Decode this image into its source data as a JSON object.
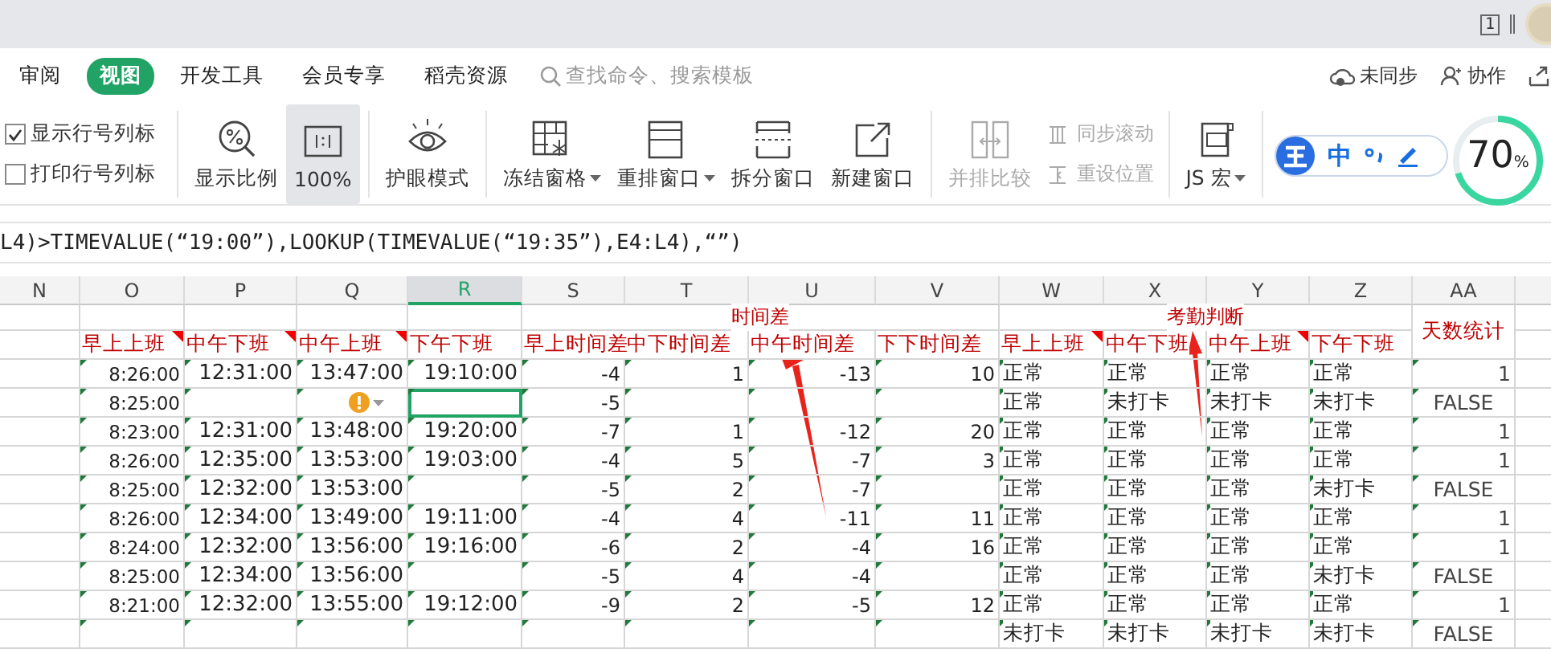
{
  "title_bar": {
    "page_indicator": "1"
  },
  "menu_tabs": [
    {
      "label": "审阅",
      "selected": false
    },
    {
      "label": "视图",
      "selected": true
    },
    {
      "label": "开发工具",
      "selected": false
    },
    {
      "label": "会员专享",
      "selected": false
    },
    {
      "label": "稻壳资源",
      "selected": false
    }
  ],
  "search": {
    "placeholder": "查找命令、搜索模板"
  },
  "header_actions": [
    {
      "label": "未同步",
      "kind": "cloud"
    },
    {
      "label": "协作",
      "kind": "person"
    }
  ],
  "ribbon": {
    "checkboxes": [
      {
        "label": "显示行号列标",
        "checked": true
      },
      {
        "label": "打印行号列标",
        "checked": false
      }
    ],
    "buttons": [
      {
        "label": "显示比例",
        "kind": "zoom",
        "selected": false,
        "disabled": false,
        "dropdown": false
      },
      {
        "label": "100%",
        "kind": "ratio",
        "selected": true,
        "disabled": false,
        "dropdown": false
      },
      {
        "label": "护眼模式",
        "kind": "eye",
        "selected": false,
        "disabled": false,
        "dropdown": false
      },
      {
        "label": "冻结窗格",
        "kind": "freeze",
        "selected": false,
        "disabled": false,
        "dropdown": true
      },
      {
        "label": "重排窗口",
        "kind": "arrange",
        "selected": false,
        "disabled": false,
        "dropdown": true
      },
      {
        "label": "拆分窗口",
        "kind": "split",
        "selected": false,
        "disabled": false,
        "dropdown": false
      },
      {
        "label": "新建窗口",
        "kind": "newwin",
        "selected": false,
        "disabled": false,
        "dropdown": false
      },
      {
        "label": "并排比较",
        "kind": "compare",
        "selected": false,
        "disabled": true,
        "dropdown": false
      }
    ],
    "small_buttons": [
      {
        "label": "同步滚动",
        "kind": "sync",
        "disabled": true
      },
      {
        "label": "重设位置",
        "kind": "reset",
        "disabled": true
      }
    ],
    "macro_button": {
      "label": "JS 宏",
      "dropdown": true
    }
  },
  "ime_bar": {
    "label": "中"
  },
  "score_ring": {
    "level": 0.7,
    "reading": "70",
    "unit": "%"
  },
  "formula": {
    "text": "L4)>TIMEVALUE(“19:00”),LOOKUP(TIMEVALUE(“19:35”),E4:L4),“”)"
  },
  "sheet": {
    "columns": [
      {
        "label": "N",
        "selected": false
      },
      {
        "label": "O",
        "selected": false
      },
      {
        "label": "P",
        "selected": false
      },
      {
        "label": "Q",
        "selected": false
      },
      {
        "label": "R",
        "selected": true
      },
      {
        "label": "S",
        "selected": false
      },
      {
        "label": "T",
        "selected": false
      },
      {
        "label": "U",
        "selected": false
      },
      {
        "label": "V",
        "selected": false
      },
      {
        "label": "W",
        "selected": false
      },
      {
        "label": "X",
        "selected": false
      },
      {
        "label": "Y",
        "selected": false
      },
      {
        "label": "Z",
        "selected": false
      },
      {
        "label": "AA",
        "selected": false
      }
    ],
    "header_groups": [
      {
        "kind": "plain",
        "fields": [
          {
            "label": "早上上班",
            "comment": true,
            "kind": "time"
          },
          {
            "label": "中午下班",
            "comment": true,
            "kind": "time"
          },
          {
            "label": "中午上班",
            "comment": true,
            "kind": "time"
          },
          {
            "label": "下午下班",
            "comment": false,
            "kind": "time"
          }
        ]
      },
      {
        "kind": "group",
        "title": "时间差",
        "fields": [
          {
            "label": "早上时间差",
            "comment": false,
            "kind": "number"
          },
          {
            "label": "中下时间差",
            "comment": false,
            "kind": "number"
          },
          {
            "label": "中午时间差",
            "comment": false,
            "kind": "number"
          },
          {
            "label": "下下时间差",
            "comment": false,
            "kind": "number"
          }
        ]
      },
      {
        "kind": "group",
        "title": "考勤判断",
        "fields": [
          {
            "label": "早上上班",
            "comment": true,
            "kind": "status"
          },
          {
            "label": "中午下班",
            "comment": false,
            "kind": "status"
          },
          {
            "label": "中午上班",
            "comment": true,
            "kind": "status"
          },
          {
            "label": "下午下班",
            "comment": false,
            "kind": "status"
          }
        ]
      },
      {
        "kind": "tall",
        "fields": [
          {
            "label": "天数统计",
            "comment": false,
            "kind": "count"
          }
        ]
      }
    ],
    "rows": [
      {
        "selected": false,
        "warning": false,
        "cells": [
          "",
          "8:26:00",
          "12:31:00",
          "13:47:00",
          "19:10:00",
          "-4",
          "1",
          "-13",
          "10",
          "正常",
          "正常",
          "正常",
          "正常",
          "1"
        ]
      },
      {
        "selected": true,
        "warning": true,
        "cells": [
          "",
          "8:25:00",
          "",
          "",
          "",
          "-5",
          "",
          "",
          "",
          "正常",
          "未打卡",
          "未打卡",
          "未打卡",
          "FALSE"
        ]
      },
      {
        "selected": false,
        "warning": false,
        "cells": [
          "",
          "8:23:00",
          "12:31:00",
          "13:48:00",
          "19:20:00",
          "-7",
          "1",
          "-12",
          "20",
          "正常",
          "正常",
          "正常",
          "正常",
          "1"
        ]
      },
      {
        "selected": false,
        "warning": false,
        "cells": [
          "",
          "8:26:00",
          "12:35:00",
          "13:53:00",
          "19:03:00",
          "-4",
          "5",
          "-7",
          "3",
          "正常",
          "正常",
          "正常",
          "正常",
          "1"
        ]
      },
      {
        "selected": false,
        "warning": false,
        "cells": [
          "",
          "8:25:00",
          "12:32:00",
          "13:53:00",
          "",
          "-5",
          "2",
          "-7",
          "",
          "正常",
          "正常",
          "正常",
          "未打卡",
          "FALSE"
        ]
      },
      {
        "selected": false,
        "warning": false,
        "cells": [
          "",
          "8:26:00",
          "12:34:00",
          "13:49:00",
          "19:11:00",
          "-4",
          "4",
          "-11",
          "11",
          "正常",
          "正常",
          "正常",
          "正常",
          "1"
        ]
      },
      {
        "selected": false,
        "warning": false,
        "cells": [
          "",
          "8:24:00",
          "12:32:00",
          "13:56:00",
          "19:16:00",
          "-6",
          "2",
          "-4",
          "16",
          "正常",
          "正常",
          "正常",
          "正常",
          "1"
        ]
      },
      {
        "selected": false,
        "warning": false,
        "cells": [
          "",
          "8:25:00",
          "12:34:00",
          "13:56:00",
          "",
          "-5",
          "4",
          "-4",
          "",
          "正常",
          "正常",
          "正常",
          "未打卡",
          "FALSE"
        ]
      },
      {
        "selected": false,
        "warning": false,
        "cells": [
          "",
          "8:21:00",
          "12:32:00",
          "13:55:00",
          "19:12:00",
          "-9",
          "2",
          "-5",
          "12",
          "正常",
          "正常",
          "正常",
          "正常",
          "1"
        ]
      },
      {
        "selected": false,
        "warning": false,
        "cells": [
          "",
          "",
          "",
          "",
          "",
          "",
          "",
          "",
          "",
          "未打卡",
          "未打卡",
          "未打卡",
          "未打卡",
          "FALSE"
        ]
      }
    ]
  }
}
